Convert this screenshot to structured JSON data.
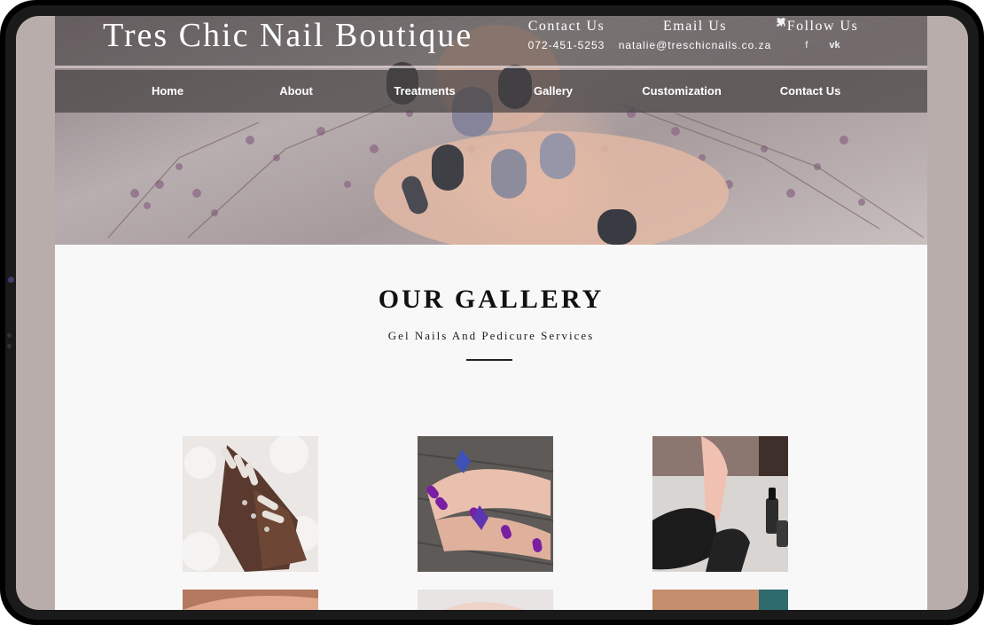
{
  "brand": {
    "name": "Tres Chic Nail Boutique"
  },
  "contact": {
    "phone_heading": "Contact Us",
    "phone": "072-451-5253",
    "email_heading": "Email Us",
    "email": "natalie@treschicnails.co.za",
    "follow_heading": "Follow Us",
    "social_icons": [
      "facebook-icon",
      "twitter-icon",
      "rss-icon",
      "vk-icon"
    ],
    "social_glyphs": [
      "f",
      "🐦",
      "⦿",
      "vk"
    ]
  },
  "nav": {
    "items": [
      {
        "label": "Home"
      },
      {
        "label": "About"
      },
      {
        "label": "Treatments"
      },
      {
        "label": "Gallery"
      },
      {
        "label": "Customization"
      },
      {
        "label": "Contact Us"
      }
    ]
  },
  "gallery": {
    "title": "OUR GALLERY",
    "subtitle": "Gel Nails And Pedicure Services",
    "images": [
      "nails-on-white-fur",
      "purple-nails-with-rings",
      "manicurist-black-gloves",
      "gallery-image-4",
      "gallery-image-5",
      "gallery-image-6"
    ]
  },
  "colors": {
    "frame": "#000000",
    "bezel": "#b9adab",
    "page_bg": "#f8f8f8",
    "nav_overlay": "#464242",
    "text_dark": "#111111"
  }
}
